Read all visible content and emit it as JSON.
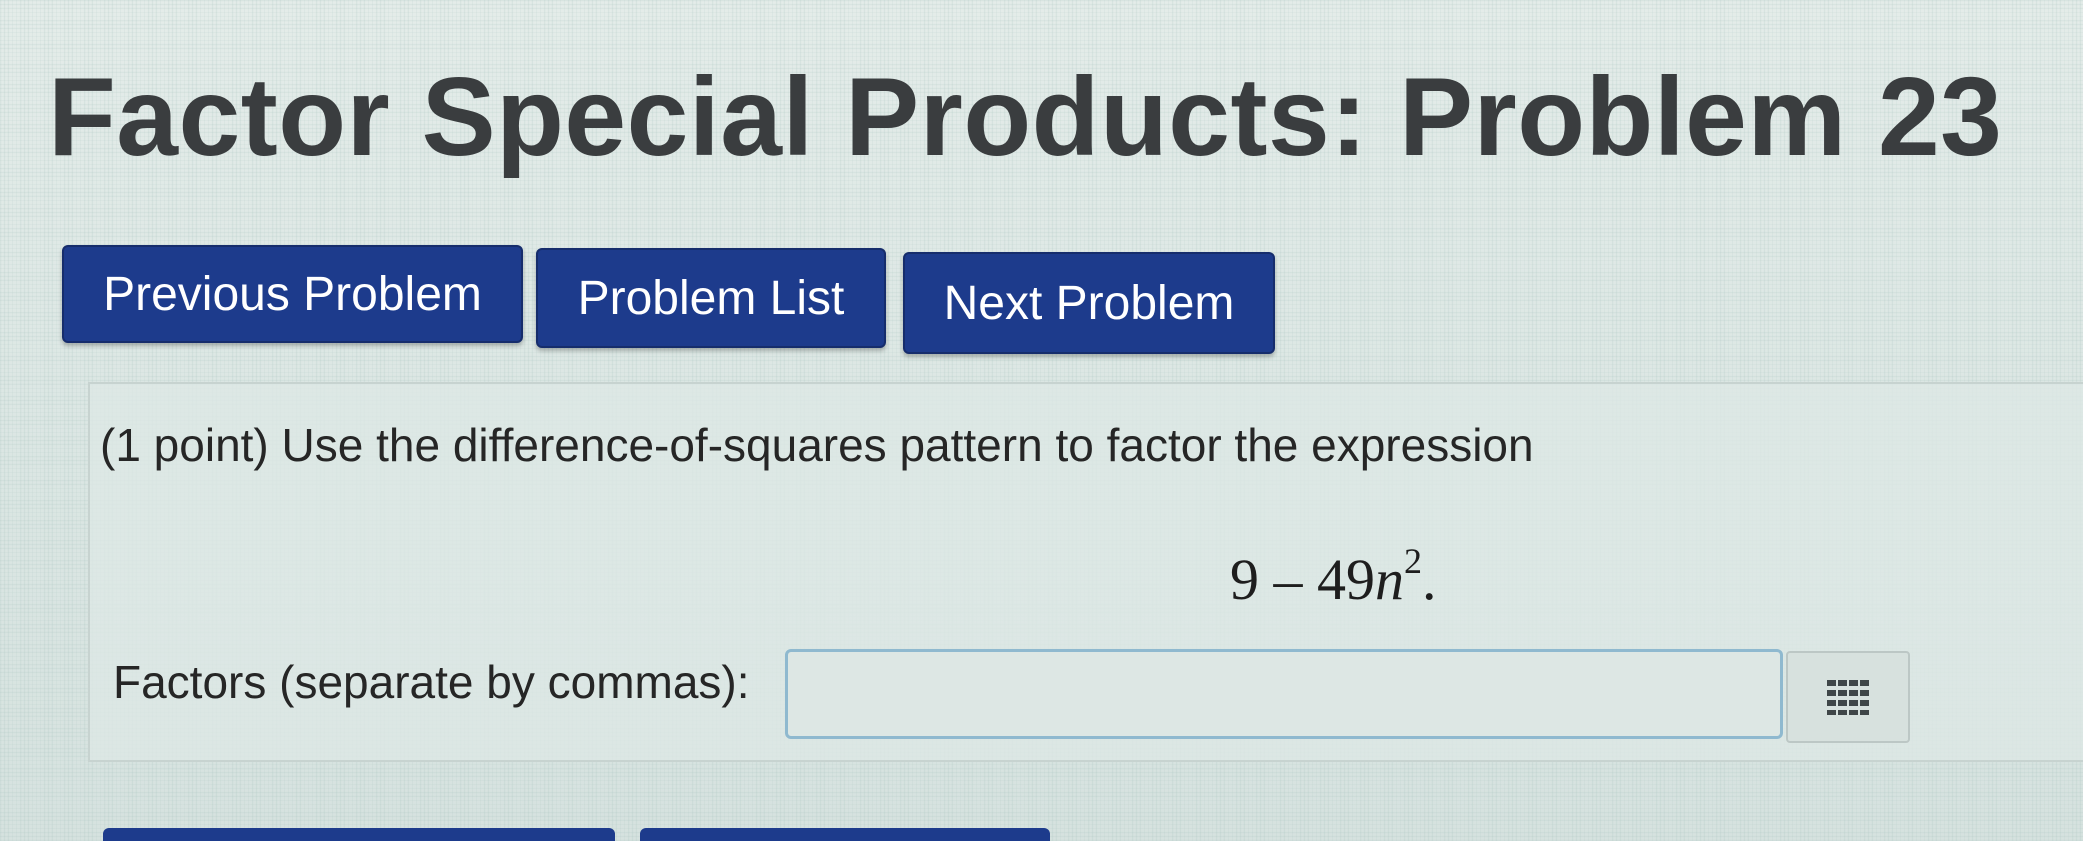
{
  "header": {
    "title": "Factor Special Products: Problem 23"
  },
  "nav": {
    "previous_label": "Previous Problem",
    "list_label": "Problem List",
    "next_label": "Next Problem"
  },
  "problem": {
    "statement": "(1 point) Use the difference-of-squares pattern to factor the expression",
    "expression": {
      "constant": "9",
      "operator": "–",
      "coefficient": "49",
      "variable": "n",
      "exponent": "2",
      "end": "."
    }
  },
  "answer": {
    "label": "Factors (separate by commas):",
    "value": "",
    "keypad_icon": "keypad-grid-icon"
  },
  "colors": {
    "button_blue": "#1d3b8c",
    "input_border": "#8fb9cf"
  }
}
